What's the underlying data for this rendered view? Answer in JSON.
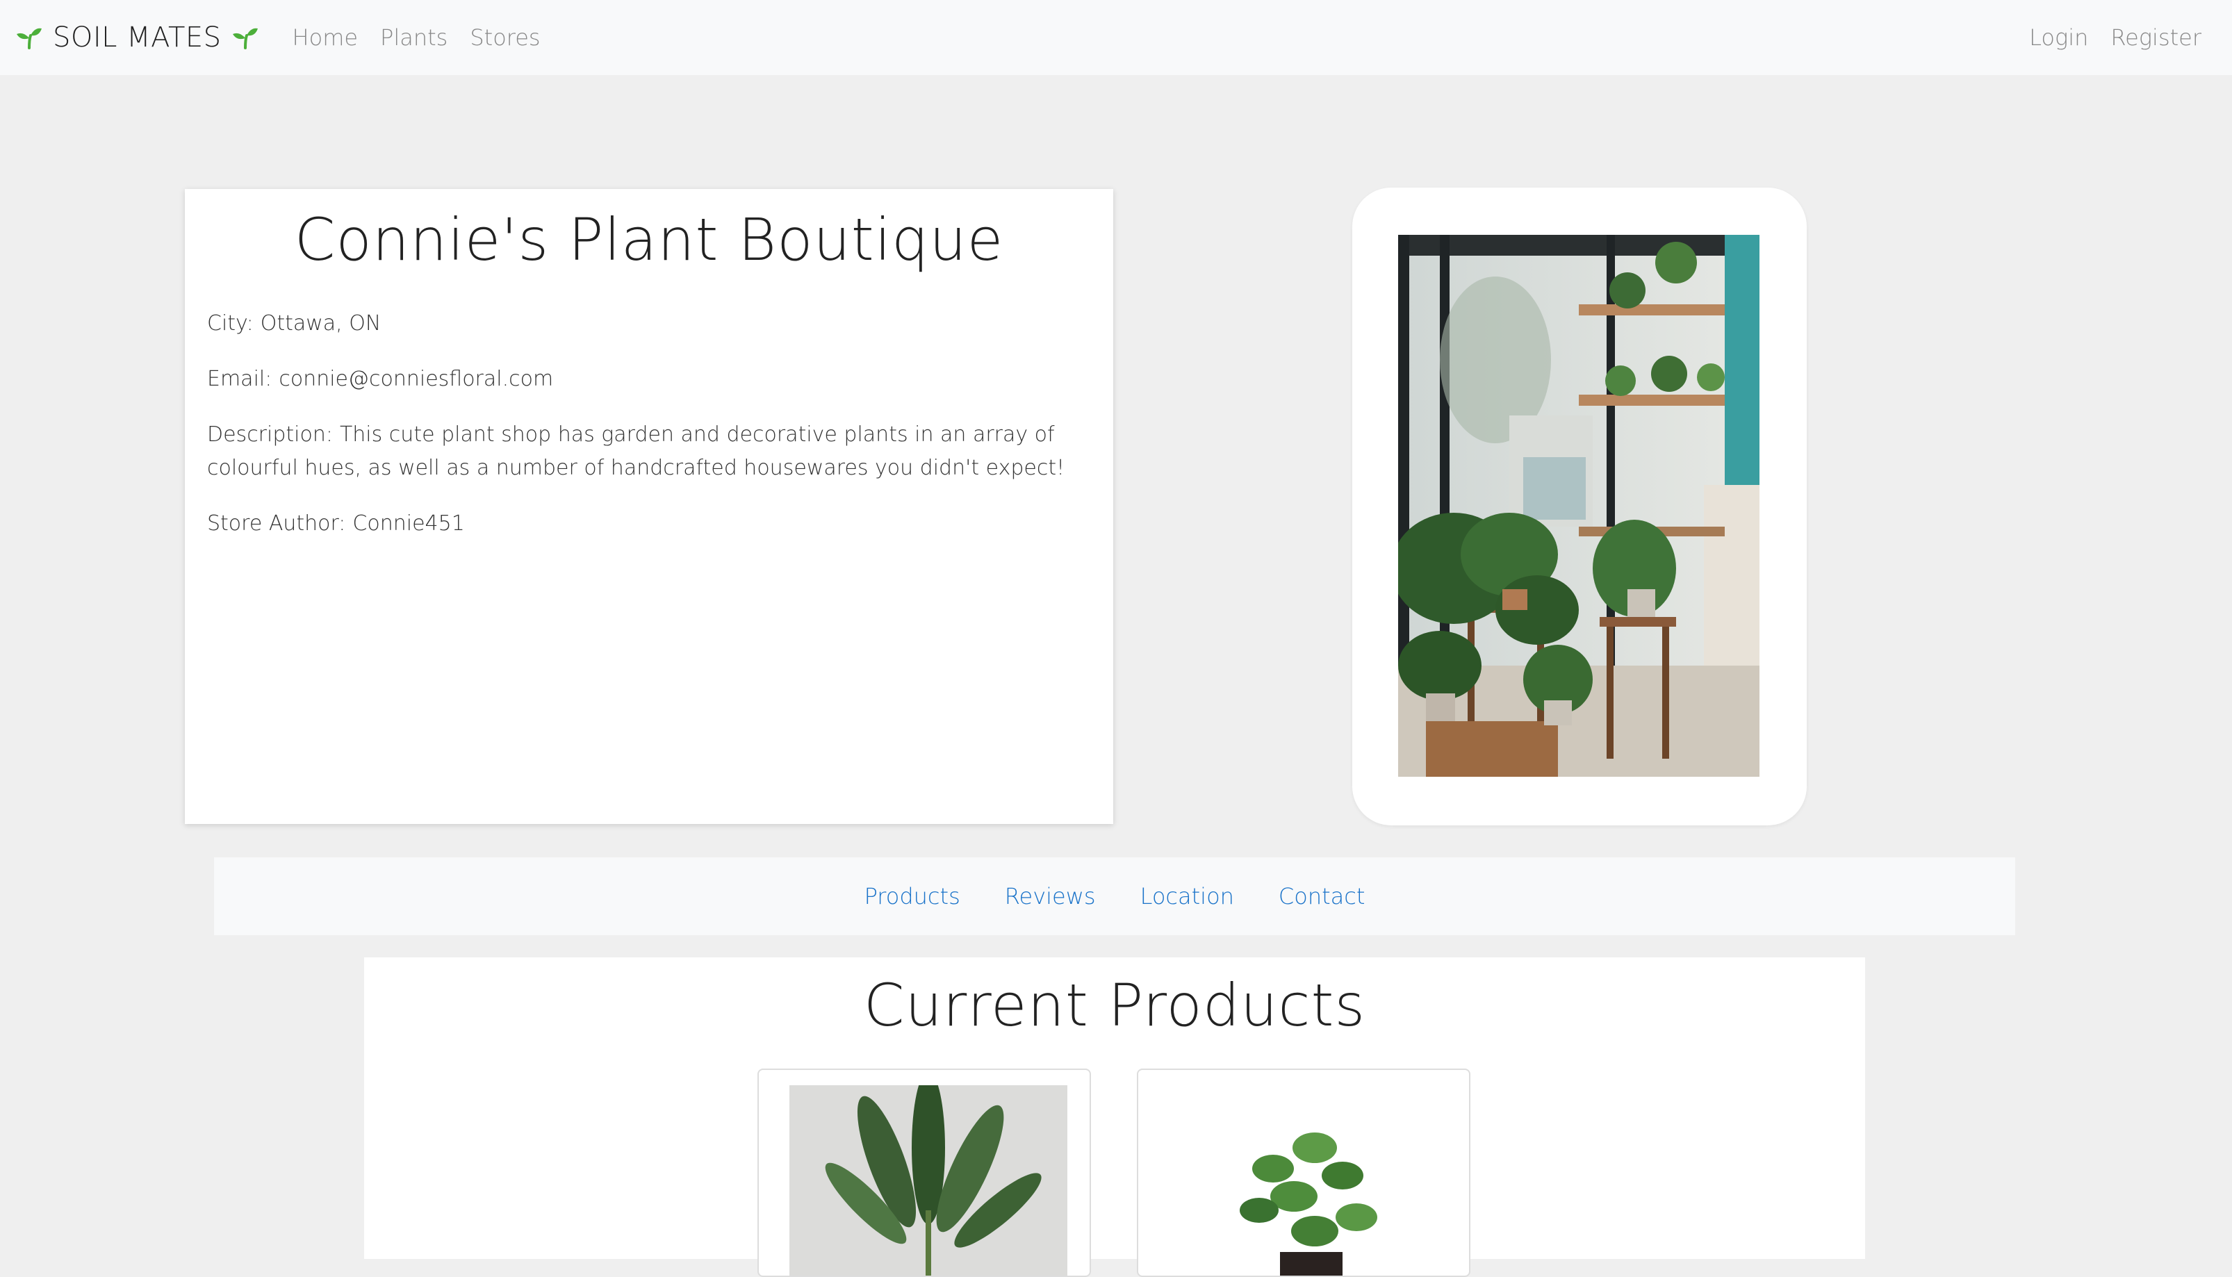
{
  "navbar": {
    "brand": "SOIL MATES",
    "links": [
      "Home",
      "Plants",
      "Stores"
    ],
    "auth": {
      "login": "Login",
      "register": "Register"
    }
  },
  "store": {
    "name": "Connie's Plant Boutique",
    "city_label": "City:",
    "city": "Ottawa, ON",
    "email_label": "Email:",
    "email": "connie@conniesfloral.com",
    "description_label": "Description:",
    "description": "This cute plant shop has garden and decorative plants in an array of colourful hues, as well as a number of handcrafted housewares you didn't expect!",
    "author_label": "Store Author:",
    "author": "Connie451"
  },
  "tabs": [
    "Products",
    "Reviews",
    "Location",
    "Contact"
  ],
  "products_section": {
    "title": "Current Products"
  },
  "colors": {
    "accent_green": "#4caf3a",
    "link_blue": "#1a73c9",
    "nav_bg": "#f8f9fa",
    "page_bg": "#efefef"
  }
}
